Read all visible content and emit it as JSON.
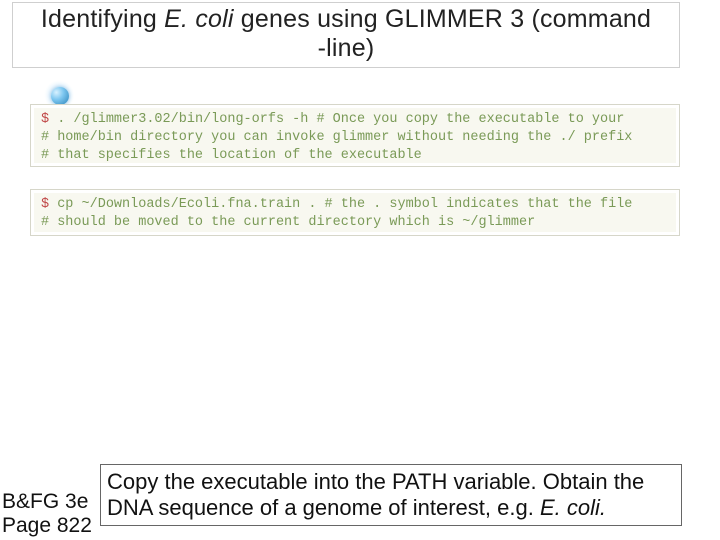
{
  "title": {
    "pre": "Identifying ",
    "italic": "E. coli",
    "mid": " genes using GLIMMER 3 (command",
    "line2": "-line)"
  },
  "code1": {
    "prompt": "$",
    "cmd": ". /glimmer3.02/bin/long-orfs -h",
    "c1": " # Once you copy the executable to your",
    "c2": "# home/bin directory you can invoke glimmer without needing the ./ prefix",
    "c3": "# that specifies the location of the executable"
  },
  "code2": {
    "prompt": "$",
    "cmd": " cp ~/Downloads/Ecoli.fna.train .",
    "c1": " # the . symbol indicates that the file",
    "c2": "# should be moved to the current directory which is ~/glimmer"
  },
  "footer_ref": {
    "line1": "B&FG 3e",
    "line2": "Page 822"
  },
  "footer_text": {
    "part1": "Copy the executable into the PATH variable. Obtain the DNA sequence of a genome of interest, e.g. ",
    "italic": "E. coli.",
    "part2": ""
  }
}
